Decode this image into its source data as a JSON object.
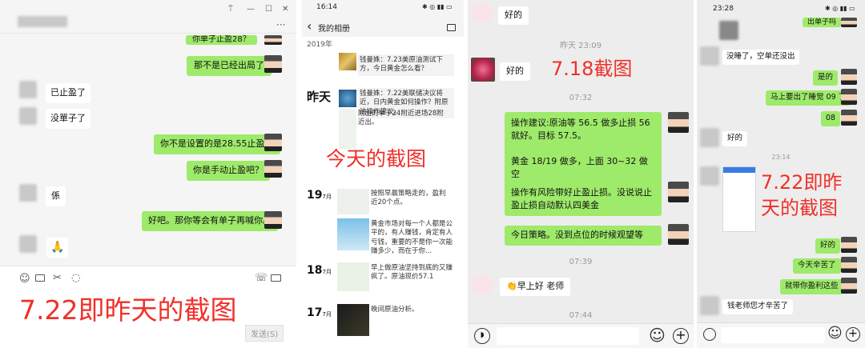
{
  "p1": {
    "window_controls": [
      "⍑",
      "—",
      "☐",
      "✕"
    ],
    "more": "···",
    "msgs": [
      {
        "text": "你单子止盈28？",
        "side": "right"
      },
      {
        "text": "那不是已经出局了",
        "side": "right"
      },
      {
        "text": "已止盈了",
        "side": "left"
      },
      {
        "text": "没單子了",
        "side": "left"
      },
      {
        "text": "你不是设置的是28.55止盈吗",
        "side": "right"
      },
      {
        "text": "你是手动止盈吧？",
        "side": "right"
      },
      {
        "text": "係",
        "side": "left"
      },
      {
        "text": "好吧。那你等会有单子再喊你。",
        "side": "right"
      },
      {
        "text": "🙏",
        "side": "left"
      }
    ],
    "send_label": "发送(S)",
    "caption": "7.22即昨天的截图"
  },
  "p2": {
    "status_time": "16:14",
    "status_right": "✱ ◎ ▮▮ ▭",
    "back": "‹",
    "title": "我的相册",
    "year": "2019年",
    "yesterday": "昨天",
    "entries": [
      {
        "text": "钱曼姝：7.23美原油测试下方，今日黄金怎么看？"
      },
      {
        "text": "钱曼姝：7.22美联储决议将近，日内黄金如何操作？附原油操作建议。"
      },
      {
        "text": "附出的单子24附近进场28附近出。"
      },
      {
        "text": "按照早晨策略走的，盈利近20个点。"
      },
      {
        "text": "黄金市场对每一个人都是公平的，有人赚钱，肯定有人亏钱，重要的不是你一次能赚多少，而在于你..."
      },
      {
        "text": "早上做原油坚持到底的又赚疯了。原油现价57.1"
      },
      {
        "text": "晚间原油分析。"
      }
    ],
    "dates": [
      {
        "day": "19",
        "month": "7月"
      },
      {
        "day": "18",
        "month": "7月"
      },
      {
        "day": "17",
        "month": "7月"
      }
    ],
    "caption": "今天的截图"
  },
  "p3": {
    "msg_top": "好的",
    "time1": "昨天 23:09",
    "msg_haode": "好的",
    "time2": "07:32",
    "ops": [
      "操作建议:原油等 56.5 做多止损 56 就好。目标 57.5。\n\n黄金 18/19 做多，上面 30~32 做空",
      "操作有风险带好止盈止损。没说说止盈止损自动默认四美金",
      "今日策略。没到点位的时候观望等"
    ],
    "time3": "07:39",
    "msg_morning": "👏早上好 老师",
    "time4": "07:44",
    "caption": "7.18截图"
  },
  "p4": {
    "status_time": "23:28",
    "status_right": "✱ ◎ ▮▮ ▭",
    "top_right_text": "出单子吗",
    "msgs": [
      {
        "text": "没睡了，空单还没出",
        "side": "left"
      },
      {
        "text": "是的",
        "side": "right"
      },
      {
        "text": "马上要出了睡觉 09 了",
        "side": "right"
      },
      {
        "text": "08",
        "side": "right"
      },
      {
        "text": "好的",
        "side": "left"
      }
    ],
    "time": "23:14",
    "msgs2": [
      {
        "text": "好的",
        "side": "right"
      },
      {
        "text": "今天辛苦了",
        "side": "right"
      },
      {
        "text": "就带你盈利这些",
        "side": "right"
      },
      {
        "text": "钱老师您才辛苦了",
        "side": "left"
      }
    ],
    "caption": "7.22即昨天的截图"
  },
  "icons": {
    "emoji": "☺",
    "plus": "+",
    "voice": "◉"
  }
}
